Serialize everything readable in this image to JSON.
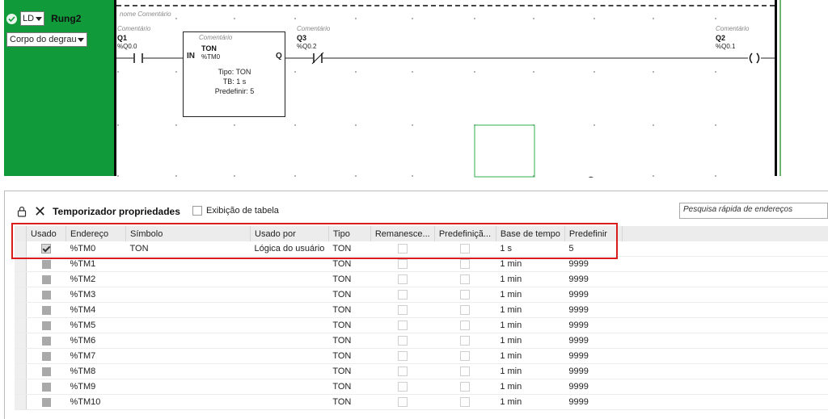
{
  "rung": {
    "language": "LD",
    "name": "Rung2",
    "section": "Corpo do degrau",
    "header": "nome  Comentário"
  },
  "ladder": {
    "q1": {
      "comment": "Comentário",
      "label": "Q1",
      "address": "%Q0.0"
    },
    "timer": {
      "comment": "Comentário",
      "in": "IN",
      "q": "Q",
      "type_label": "TON",
      "address": "%TM0",
      "tipo": "Tipo: TON",
      "tb": "TB: 1 s",
      "predefinir": "Predefinir: 5"
    },
    "q3": {
      "comment": "Comentário",
      "label": "Q3",
      "address": "%Q0.2"
    },
    "q2": {
      "comment": "Comentário",
      "label": "Q2",
      "address": "%Q0.1"
    }
  },
  "panel": {
    "title": "Temporizador propriedades",
    "table_view_label": "Exibição de tabela",
    "search_placeholder": "Pesquisa rápida de endereços"
  },
  "table": {
    "columns": [
      "Usado",
      "Endereço",
      "Símbolo",
      "Usado por",
      "Tipo",
      "Remanesce...",
      "Predefiniçã...",
      "Base de tempo",
      "Predefinir"
    ],
    "rows": [
      {
        "address": "%TM0",
        "symbol": "TON",
        "used_by": "Lógica do usuário",
        "type": "TON",
        "base": "1 s",
        "preset": "5"
      },
      {
        "address": "%TM1",
        "symbol": "",
        "used_by": "",
        "type": "TON",
        "base": "1 min",
        "preset": "9999"
      },
      {
        "address": "%TM2",
        "symbol": "",
        "used_by": "",
        "type": "TON",
        "base": "1 min",
        "preset": "9999"
      },
      {
        "address": "%TM3",
        "symbol": "",
        "used_by": "",
        "type": "TON",
        "base": "1 min",
        "preset": "9999"
      },
      {
        "address": "%TM4",
        "symbol": "",
        "used_by": "",
        "type": "TON",
        "base": "1 min",
        "preset": "9999"
      },
      {
        "address": "%TM5",
        "symbol": "",
        "used_by": "",
        "type": "TON",
        "base": "1 min",
        "preset": "9999"
      },
      {
        "address": "%TM6",
        "symbol": "",
        "used_by": "",
        "type": "TON",
        "base": "1 min",
        "preset": "9999"
      },
      {
        "address": "%TM7",
        "symbol": "",
        "used_by": "",
        "type": "TON",
        "base": "1 min",
        "preset": "9999"
      },
      {
        "address": "%TM8",
        "symbol": "",
        "used_by": "",
        "type": "TON",
        "base": "1 min",
        "preset": "9999"
      },
      {
        "address": "%TM9",
        "symbol": "",
        "used_by": "",
        "type": "TON",
        "base": "1 min",
        "preset": "9999"
      },
      {
        "address": "%TM10",
        "symbol": "",
        "used_by": "",
        "type": "TON",
        "base": "1 min",
        "preset": "9999"
      }
    ]
  },
  "colors": {
    "rung_green": "#119a3a",
    "highlight_red": "#d91c1c"
  }
}
